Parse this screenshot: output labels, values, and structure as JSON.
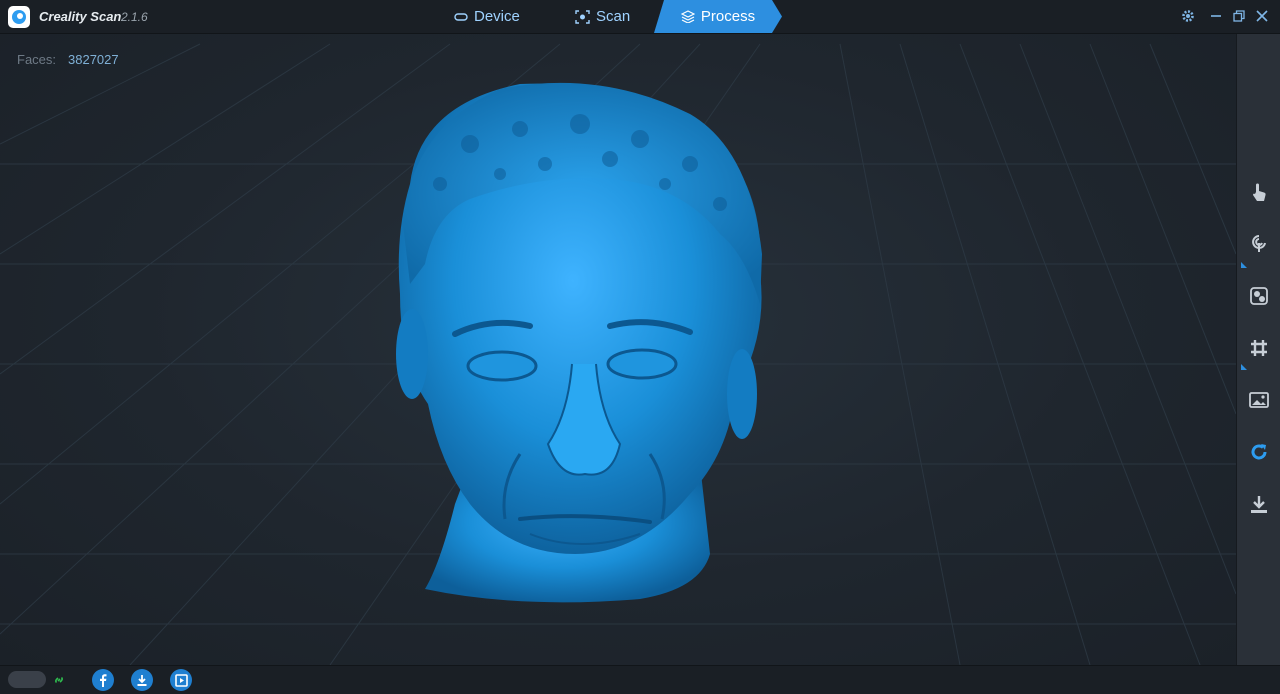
{
  "app": {
    "name": "Creality Scan",
    "version": "2.1.6"
  },
  "tabs": [
    {
      "label": "Device",
      "icon": "device-icon",
      "active": false
    },
    {
      "label": "Scan",
      "icon": "scan-icon",
      "active": false
    },
    {
      "label": "Process",
      "icon": "layers-icon",
      "active": true
    }
  ],
  "stats": {
    "faces_label": "Faces:",
    "faces_value": "3827027"
  },
  "right_toolbar": [
    "select-touch-icon",
    "lasso-icon",
    "texture-icon",
    "grid-icon",
    "image-icon",
    "refresh-icon",
    "download-icon"
  ],
  "bottom_bar": [
    "device-status-icon",
    "link-icon",
    "facebook-icon",
    "download-icon",
    "video-tutorial-icon"
  ],
  "colors": {
    "accent": "#2d8fe0",
    "model": "#1a8fd8",
    "background": "#1e242b"
  }
}
